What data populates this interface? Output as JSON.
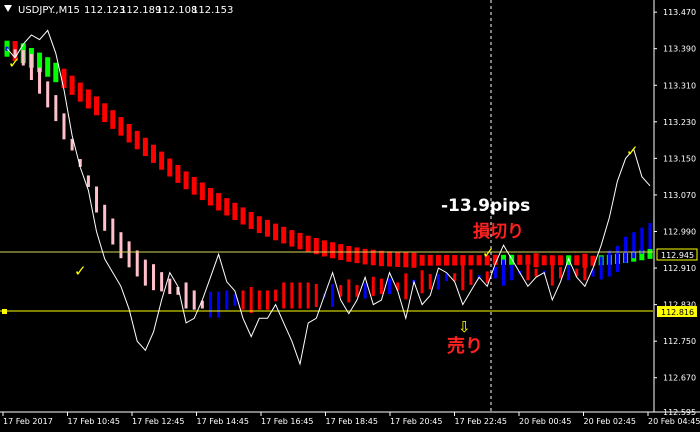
{
  "header": {
    "symbol": "USDJPY.,M15",
    "open": "112.123",
    "high": "112.189",
    "low": "112.108",
    "close": "112.153"
  },
  "annotations": {
    "pips": "-13.9pips",
    "stop_loss": "損切り",
    "sell": "売り",
    "arrow": "⇩",
    "check": "✓"
  },
  "price_tags": {
    "upper": "112.945",
    "lower": "112.816"
  },
  "colors": {
    "background": "#000000",
    "price_line": "#ffffff",
    "bear_strong": "#ff0000",
    "bear_weak": "#ffc0cb",
    "bull_strong": "#00ff00",
    "bull_weak": "#0000ff",
    "level_line": "#ffff00",
    "level_line_dim": "#d6d65a",
    "check": "#ffff00",
    "annotation_red": "#ff2020",
    "annotation_white": "#ffffff"
  },
  "chart_data": {
    "type": "line",
    "ylim": [
      112.595,
      113.49
    ],
    "y_ticks": [
      "113.470",
      "113.390",
      "113.310",
      "113.230",
      "113.150",
      "113.070",
      "112.990",
      "112.910",
      "112.830",
      "112.750",
      "112.670",
      "112.595"
    ],
    "x_ticks": [
      "17 Feb 2017",
      "17 Feb 10:45",
      "17 Feb 12:45",
      "17 Feb 14:45",
      "17 Feb 16:45",
      "17 Feb 18:45",
      "17 Feb 20:45",
      "17 Feb 22:45",
      "20 Feb 00:45",
      "20 Feb 02:45",
      "20 Feb 04:45"
    ],
    "levels": [
      112.945,
      112.816
    ],
    "bar_count": 80,
    "series": [
      {
        "role": "price",
        "values": [
          113.39,
          113.37,
          113.4,
          113.42,
          113.41,
          113.43,
          113.38,
          113.3,
          113.2,
          113.13,
          113.08,
          112.99,
          112.93,
          112.9,
          112.87,
          112.82,
          112.75,
          112.73,
          112.77,
          112.84,
          112.9,
          112.87,
          112.79,
          112.8,
          112.84,
          112.89,
          112.94,
          112.88,
          112.86,
          112.8,
          112.76,
          112.8,
          112.8,
          112.83,
          112.79,
          112.75,
          112.7,
          112.79,
          112.8,
          112.85,
          112.9,
          112.84,
          112.81,
          112.84,
          112.89,
          112.83,
          112.84,
          112.9,
          112.86,
          112.8,
          112.88,
          112.83,
          112.85,
          112.91,
          112.9,
          112.88,
          112.83,
          112.86,
          112.89,
          112.87,
          112.92,
          112.96,
          112.93,
          112.9,
          112.87,
          112.89,
          112.9,
          112.84,
          112.88,
          112.93,
          112.89,
          112.87,
          112.91,
          112.96,
          113.02,
          113.1,
          113.15,
          113.17,
          113.11,
          113.09
        ]
      },
      {
        "role": "slow_band_mid",
        "values": [
          113.39,
          113.385,
          113.38,
          113.37,
          113.36,
          113.35,
          113.338,
          113.325,
          113.31,
          113.295,
          113.28,
          113.265,
          113.25,
          113.235,
          113.22,
          113.205,
          113.19,
          113.175,
          113.16,
          113.145,
          113.13,
          113.116,
          113.102,
          113.09,
          113.078,
          113.066,
          113.055,
          113.044,
          113.034,
          113.024,
          113.014,
          113.005,
          112.997,
          112.989,
          112.982,
          112.975,
          112.969,
          112.963,
          112.958,
          112.953,
          112.949,
          112.945,
          112.941,
          112.938,
          112.935,
          112.933,
          112.931,
          112.93,
          112.929,
          112.928,
          112.927,
          112.927,
          112.927,
          112.927,
          112.927,
          112.927,
          112.927,
          112.927,
          112.927,
          112.927,
          112.928,
          112.928,
          112.928,
          112.928,
          112.928,
          112.927,
          112.927,
          112.927,
          112.927,
          112.927,
          112.927,
          112.926,
          112.926,
          112.927,
          112.928,
          112.93,
          112.932,
          112.935,
          112.938,
          112.941
        ]
      },
      {
        "role": "fast_band_mid",
        "values": [
          113.39,
          113.38,
          113.37,
          113.35,
          113.32,
          113.29,
          113.26,
          113.22,
          113.18,
          113.14,
          113.1,
          113.06,
          113.02,
          112.99,
          112.96,
          112.94,
          112.92,
          112.9,
          112.89,
          112.88,
          112.87,
          112.86,
          112.85,
          112.84,
          112.83,
          112.83,
          112.83,
          112.84,
          112.84,
          112.84,
          112.84,
          112.84,
          112.84,
          112.85,
          112.85,
          112.85,
          112.85,
          112.85,
          112.85,
          112.85,
          112.85,
          112.86,
          112.86,
          112.86,
          112.86,
          112.87,
          112.87,
          112.87,
          112.87,
          112.87,
          112.88,
          112.88,
          112.88,
          112.88,
          112.89,
          112.89,
          112.89,
          112.89,
          112.89,
          112.89,
          112.9,
          112.9,
          112.9,
          112.9,
          112.9,
          112.9,
          112.9,
          112.9,
          112.9,
          112.9,
          112.9,
          112.9,
          112.9,
          112.91,
          112.92,
          112.93,
          112.95,
          112.96,
          112.97,
          112.98
        ]
      }
    ]
  }
}
